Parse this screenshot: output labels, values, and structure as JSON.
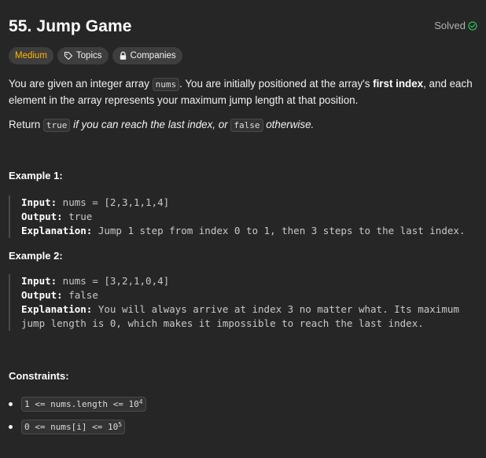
{
  "problem": {
    "title": "55. Jump Game",
    "status": "Solved"
  },
  "tags": {
    "difficulty": "Medium",
    "topics": "Topics",
    "companies": "Companies"
  },
  "description": {
    "p1_a": "You are given an integer array ",
    "p1_code": "nums",
    "p1_b": ". You are initially positioned at the array's ",
    "p1_strong": "first index",
    "p1_c": ", and each element in the array represents your maximum jump length at that position.",
    "p2_a": "Return ",
    "p2_code1": "true",
    "p2_em": " if you can reach the last index, or ",
    "p2_code2": "false",
    "p2_b": " otherwise."
  },
  "examples": [
    {
      "heading": "Example 1:",
      "input_label": "Input:",
      "input_value": " nums = [2,3,1,1,4]",
      "output_label": "Output:",
      "output_value": " true",
      "explanation_label": "Explanation:",
      "explanation_line1": " Jump 1 step from index 0 to 1, then 3 steps to the last index.",
      "explanation_line2": ""
    },
    {
      "heading": "Example 2:",
      "input_label": "Input:",
      "input_value": " nums = [3,2,1,0,4]",
      "output_label": "Output:",
      "output_value": " false",
      "explanation_label": "Explanation:",
      "explanation_line1": " You will always arrive at index 3 no matter what. Its maximum",
      "explanation_line2": "jump length is 0, which makes it impossible to reach the last index."
    }
  ],
  "constraints": {
    "heading": "Constraints:",
    "items": [
      {
        "text": "1 <= nums.length <= 10",
        "sup": "4"
      },
      {
        "text": "0 <= nums[i] <= 10",
        "sup": "5"
      }
    ]
  },
  "colors": {
    "background": "#262626",
    "difficulty_medium": "#ffb800",
    "solved_check": "#2cbb5d"
  }
}
